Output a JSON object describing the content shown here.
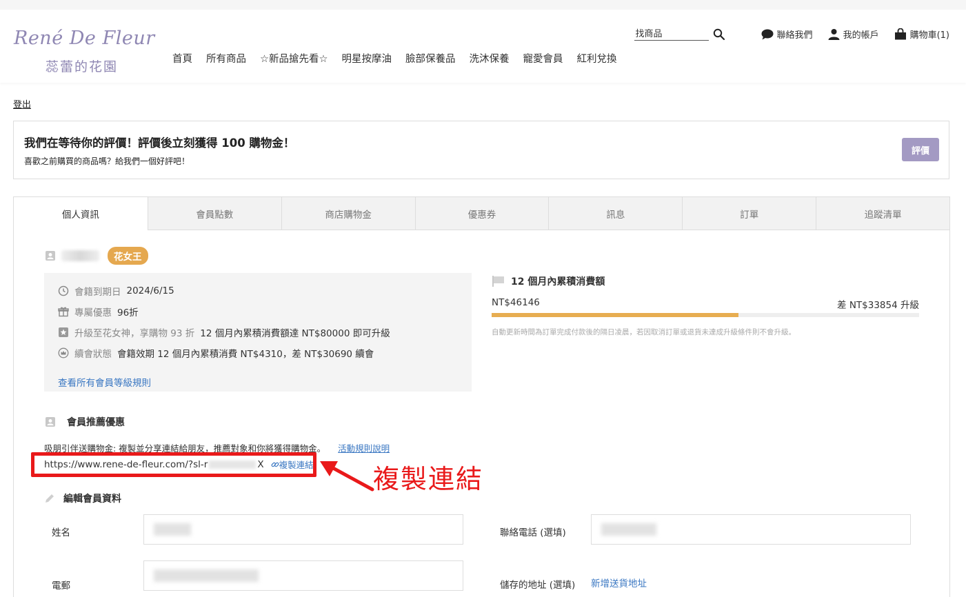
{
  "brand": {
    "script": "René De Fleur",
    "chinese": "蕊蕾的花園"
  },
  "nav": [
    "首頁",
    "所有商品",
    "☆新品搶先看☆",
    "明星按摩油",
    "臉部保養品",
    "洗沐保養",
    "寵愛會員",
    "紅利兌換"
  ],
  "utility": {
    "search_placeholder": "找商品",
    "contact": "聯絡我們",
    "account": "我的帳戶",
    "cart": "購物車(1)"
  },
  "logout": "登出",
  "review_banner": {
    "title": "我們在等待你的評價！評價後立刻獲得 100 購物金！",
    "subtitle": "喜歡之前購買的商品嗎？給我們一個好評吧！",
    "button": "評價"
  },
  "tabs": [
    "個人資訊",
    "會員點數",
    "商店購物金",
    "優惠券",
    "訊息",
    "訂單",
    "追蹤清單"
  ],
  "member": {
    "level": "花女王",
    "expiry_label": "會籍到期日",
    "expiry_value": "2024/6/15",
    "discount_label": "專屬優惠",
    "discount_value": "96折",
    "upgrade_label": "升級至花女神，享購物 93 折",
    "upgrade_value": "12 個月內累積消費額達 NT$80000 即可升級",
    "renew_label": "續會狀態",
    "renew_value": "會籍效期 12 個月內累積消費 NT$4310，差 NT$30690 續會",
    "rules_link": "查看所有會員等級規則"
  },
  "spend": {
    "title": "12 個月內累積消費額",
    "amount": "NT$46146",
    "remaining": "差 NT$33854 升級",
    "progress": 0.577,
    "note": "自動更新時間為訂單完成付款後的隔日凌晨，若因取消訂單或退貨未達成升級條件則不會升級。"
  },
  "referral": {
    "title": "會員推薦優惠",
    "description": "吸朋引伴送購物金: 複製並分享連結給朋友，推薦對象和你將獲得購物金。",
    "rules_link": "活動規則說明",
    "url_prefix": "https://www.rene-de-fleur.com/?sl-r",
    "url_suffix": "X",
    "copy_label": "複製連結"
  },
  "annotation": {
    "text": "複製連結",
    "color": "#e9191a"
  },
  "edit_profile": {
    "title": "編輯會員資料",
    "name_label": "姓名",
    "phone_label": "聯絡電話 (選填)",
    "email_label": "電郵",
    "address_label": "儲存的地址 (選填)",
    "add_address_link": "新增送貨地址"
  },
  "colors": {
    "brand": "#8f87b3",
    "review_button": "#a39ac3",
    "level_badge": "#e5a84f",
    "progress": "#e7ad51",
    "link": "#3a77c2"
  }
}
